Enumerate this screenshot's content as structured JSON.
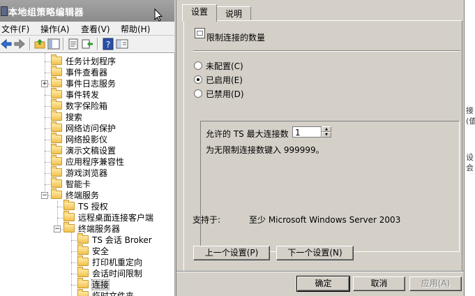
{
  "main_window": {
    "title": "本地组策略编辑器",
    "menu": [
      "文件(F)",
      "操作(A)",
      "查看(V)",
      "帮助(H)"
    ],
    "toolbar_icons": [
      "back-icon",
      "forward-icon",
      "up-folder-icon",
      "show-tree-icon",
      "properties-icon",
      "export-icon",
      "help-icon",
      "console-icon"
    ],
    "tree": [
      {
        "label": "任务计划程序",
        "depth": 2
      },
      {
        "label": "事件查看器",
        "depth": 2
      },
      {
        "label": "事件日志服务",
        "depth": 2,
        "expander": "+"
      },
      {
        "label": "事件转发",
        "depth": 2
      },
      {
        "label": "数字保险箱",
        "depth": 2
      },
      {
        "label": "搜索",
        "depth": 2
      },
      {
        "label": "网络访问保护",
        "depth": 2
      },
      {
        "label": "网络投影仪",
        "depth": 2
      },
      {
        "label": "演示文稿设置",
        "depth": 2
      },
      {
        "label": "应用程序兼容性",
        "depth": 2
      },
      {
        "label": "游戏浏览器",
        "depth": 2
      },
      {
        "label": "智能卡",
        "depth": 2
      },
      {
        "label": "终端服务",
        "depth": 2,
        "expander": "-"
      },
      {
        "label": "TS 授权",
        "depth": 3
      },
      {
        "label": "远程桌面连接客户端",
        "depth": 3
      },
      {
        "label": "终端服务器",
        "depth": 3,
        "expander": "-"
      },
      {
        "label": "TS 会话 Broker",
        "depth": 4
      },
      {
        "label": "安全",
        "depth": 4
      },
      {
        "label": "打印机重定向",
        "depth": 4
      },
      {
        "label": "会话时间限制",
        "depth": 4
      },
      {
        "label": "连接",
        "depth": 4,
        "selected": true
      },
      {
        "label": "临时文件夹",
        "depth": 4
      }
    ],
    "right_strip_text": [
      "接",
      "(值",
      "设",
      "会"
    ]
  },
  "dialog": {
    "tabs": [
      {
        "label": "设置",
        "active": true
      },
      {
        "label": "说明",
        "active": false
      }
    ],
    "policy_title": "限制连接的数量",
    "radios": [
      {
        "label": "未配置(C)",
        "checked": false
      },
      {
        "label": "已启用(E)",
        "checked": true
      },
      {
        "label": "已禁用(D)",
        "checked": false
      }
    ],
    "option_label": "允许的 TS 最大连接数",
    "option_value": "1",
    "option_help": "为无限制连接数键入 999999。",
    "supported_label": "支持于:",
    "supported_value": "至少 Microsoft Windows Server 2003",
    "prev_button": "上一个设置(P)",
    "next_button": "下一个设置(N)",
    "ok_button": "确定",
    "cancel_button": "取消",
    "apply_button": "应用(A)"
  }
}
